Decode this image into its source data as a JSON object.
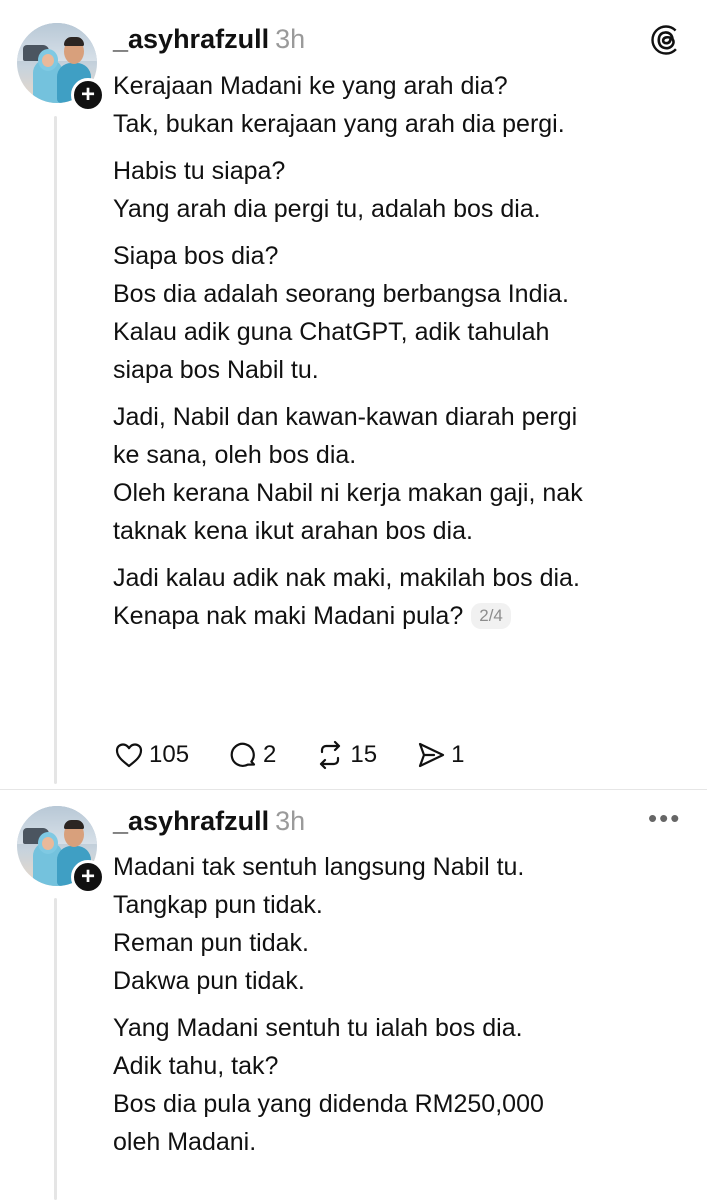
{
  "post1": {
    "username": "_asyhrafzull",
    "time": "3h",
    "lines": [
      "Kerajaan Madani ke yang arah dia?",
      "Tak, bukan kerajaan yang arah dia pergi.",
      "",
      "Habis tu siapa?",
      "Yang arah dia pergi tu, adalah bos dia.",
      "",
      "Siapa bos dia?",
      "Bos dia adalah seorang berbangsa India.",
      "Kalau adik guna ChatGPT, adik tahulah",
      "siapa bos Nabil tu.",
      "",
      "Jadi, Nabil dan kawan-kawan diarah pergi",
      "ke sana, oleh bos dia.",
      "Oleh kerana Nabil ni kerja makan gaji, nak",
      "taknak kena ikut arahan bos dia.",
      "",
      "Jadi kalau adik nak maki, makilah bos dia.",
      "Kenapa nak maki Madani pula?"
    ],
    "page_indicator": "2/4",
    "likes": "105",
    "replies": "2",
    "reposts": "15",
    "shares": "1"
  },
  "post2": {
    "username": "_asyhrafzull",
    "time": "3h",
    "lines": [
      "Madani tak sentuh langsung Nabil tu.",
      "Tangkap pun tidak.",
      "Reman pun tidak.",
      "Dakwa pun tidak.",
      "",
      "Yang Madani sentuh tu ialah bos dia.",
      "Adik tahu, tak?",
      "Bos dia pula yang didenda RM250,000",
      "oleh Madani."
    ]
  },
  "icons": {
    "header": "threads-logo-icon",
    "like": "heart-icon",
    "reply": "comment-icon",
    "repost": "repost-icon",
    "share": "send-icon",
    "more": "more-options-icon",
    "follow": "plus-icon"
  }
}
